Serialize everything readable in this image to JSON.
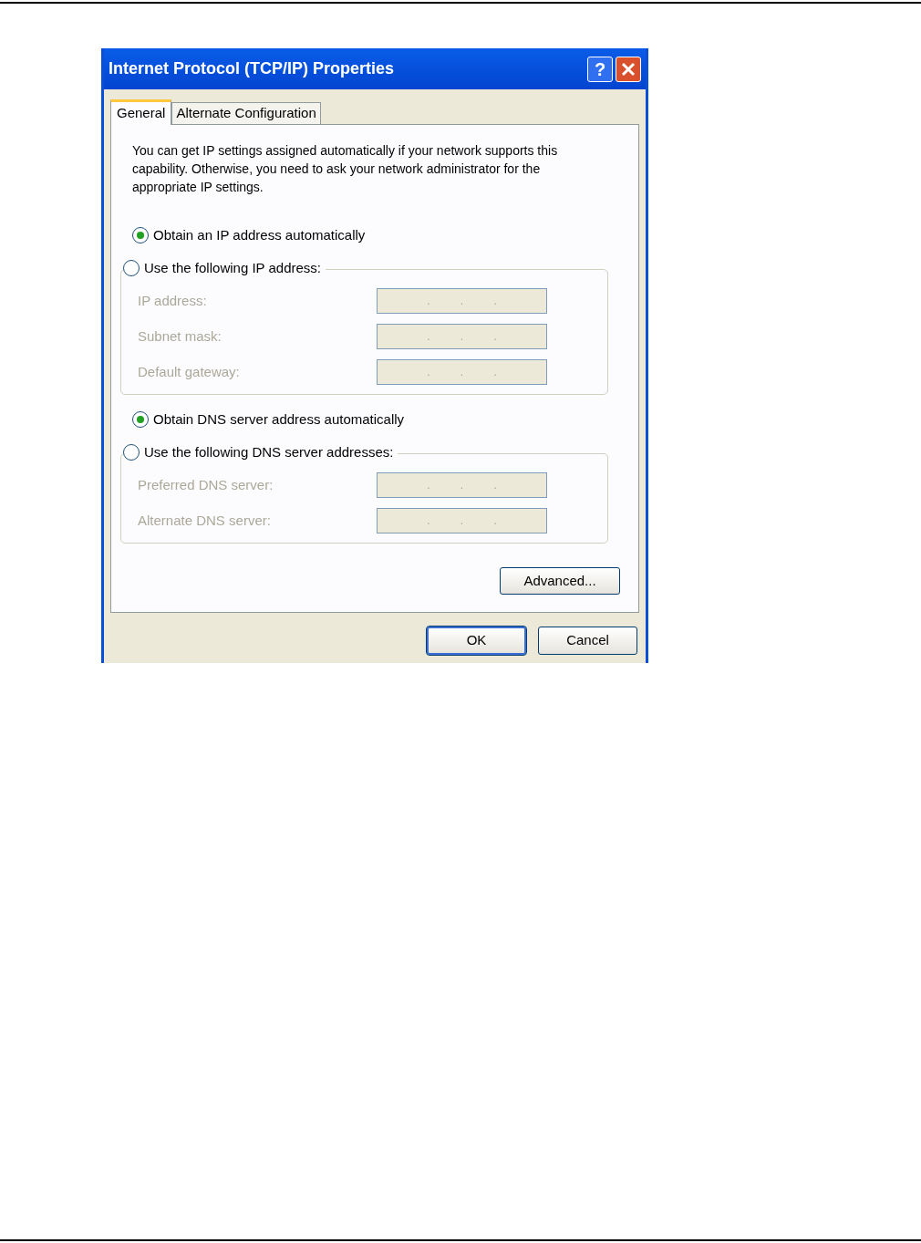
{
  "window": {
    "title": "Internet Protocol (TCP/IP) Properties",
    "help": "?"
  },
  "tabs": [
    {
      "label": "General",
      "selected": true
    },
    {
      "label": "Alternate Configuration",
      "selected": false
    }
  ],
  "description": "You can get IP settings assigned automatically if your network supports this capability. Otherwise, you need to ask your network administrator for the appropriate IP settings.",
  "sections": [
    {
      "auto": {
        "label": "Obtain an IP address automatically",
        "selected": true
      },
      "manual": {
        "label": "Use the following IP address:",
        "selected": false
      },
      "fields": [
        {
          "label": "IP address:",
          "value": ". . .",
          "disabled": true
        },
        {
          "label": "Subnet mask:",
          "value": ". . .",
          "disabled": true
        },
        {
          "label": "Default gateway:",
          "value": ". . .",
          "disabled": true
        }
      ]
    },
    {
      "auto": {
        "label": "Obtain DNS server address automatically",
        "selected": true
      },
      "manual": {
        "label": "Use the following DNS server addresses:",
        "selected": false
      },
      "fields": [
        {
          "label": "Preferred DNS server:",
          "value": ". . .",
          "disabled": true
        },
        {
          "label": "Alternate DNS server:",
          "value": ". . .",
          "disabled": true
        }
      ]
    }
  ],
  "advanced_button": "Advanced...",
  "buttons": [
    "OK",
    "Cancel"
  ]
}
